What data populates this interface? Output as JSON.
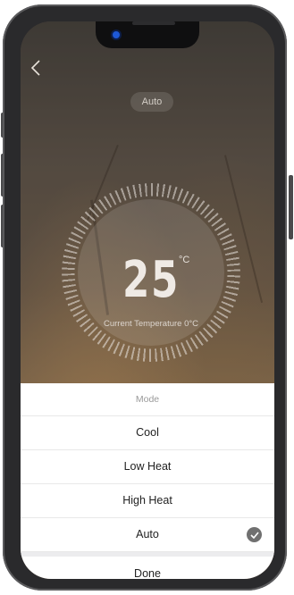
{
  "header": {
    "back_icon": "chevron-left-icon",
    "mode_badge": "Auto"
  },
  "dial": {
    "temperature": "25",
    "unit": "°C",
    "current_label": "Current Temperature 0°C"
  },
  "mode_sheet": {
    "title": "Mode",
    "options": [
      {
        "label": "Cool",
        "selected": false
      },
      {
        "label": "Low Heat",
        "selected": false
      },
      {
        "label": "High Heat",
        "selected": false
      },
      {
        "label": "Auto",
        "selected": true
      }
    ],
    "selected_icon": "checkmark-circle-icon",
    "done_label": "Done"
  },
  "colors": {
    "sheet_background": "#ffffff",
    "check_badge": "#707070",
    "title_gray": "#9a9a9a"
  }
}
